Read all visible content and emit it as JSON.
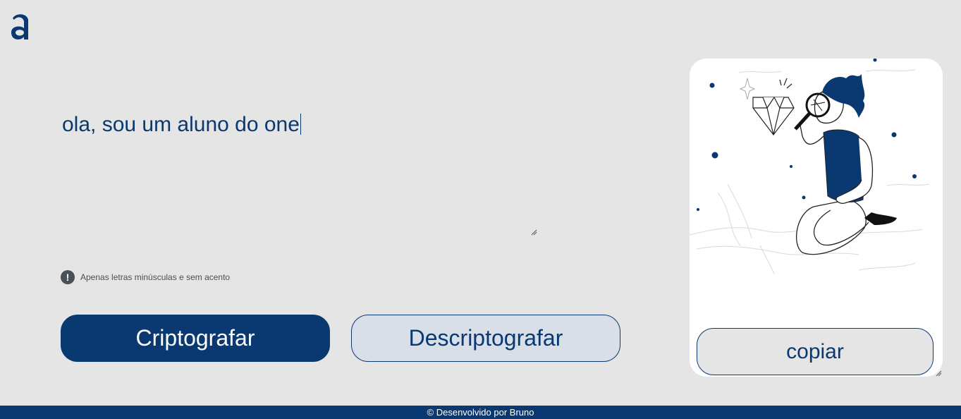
{
  "brand": {
    "logo_icon": "alura-a-logo-icon",
    "accent": "#0a3871"
  },
  "editor": {
    "text": "ola, sou um aluno do one"
  },
  "hint": {
    "icon": "exclamation-circle-icon",
    "text": "Apenas letras minúsculas e sem acento"
  },
  "actions": {
    "encrypt_label": "Criptografar",
    "decrypt_label": "Descriptografar"
  },
  "result": {
    "illustration": "person-with-magnifying-glass-illustration",
    "copy_label": "copiar"
  },
  "footer": {
    "text": "© Desenvolvido por Bruno"
  }
}
